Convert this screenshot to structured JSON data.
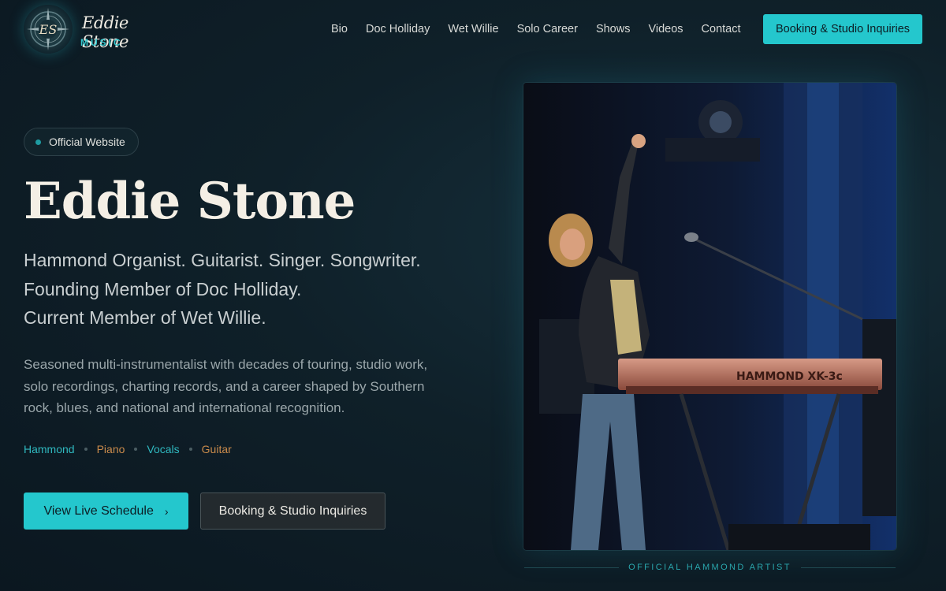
{
  "brand": {
    "monogram": "ES",
    "script_name": "Eddie Stone",
    "sub": "MUSIC",
    "accent_color": "#24c7cd"
  },
  "nav": {
    "items": [
      "Bio",
      "Doc Holliday",
      "Wet Willie",
      "Solo Career",
      "Shows",
      "Videos",
      "Contact"
    ],
    "cta_label": "Booking & Studio Inquiries"
  },
  "hero": {
    "badge": "Official Website",
    "title": "Eddie Stone",
    "taglines": [
      "Hammond Organist. Guitarist. Singer. Songwriter.",
      "Founding Member of Doc Holliday.",
      "Current Member of Wet Willie."
    ],
    "description": "Seasoned multi-instrumentalist with decades of touring, studio work, solo recordings, charting records, and a career shaped by Southern rock, blues, and national and international recognition.",
    "skills": [
      {
        "label": "Hammond",
        "color": "#2fb8bf"
      },
      {
        "label": "Piano",
        "color": "#c98a4b"
      },
      {
        "label": "Vocals",
        "color": "#2fb8bf"
      },
      {
        "label": "Guitar",
        "color": "#c98a4b"
      }
    ],
    "primary_button": "View Live Schedule",
    "primary_button_icon": "chevron-right-icon",
    "secondary_button": "Booking & Studio Inquiries"
  },
  "photo": {
    "subject": "performer-on-stage-with-hammond-organ",
    "organ_label": "HAMMOND XK-3c",
    "caption": "OFFICIAL HAMMOND ARTIST"
  }
}
